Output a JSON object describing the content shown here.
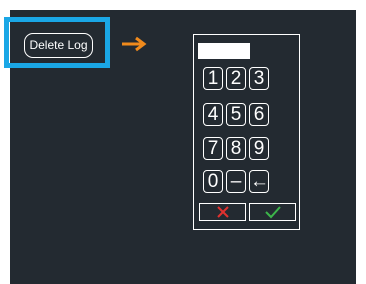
{
  "toolbar": {
    "delete_log_label": "Delete Log"
  },
  "keypad": {
    "display_value": "",
    "keys": [
      "1",
      "2",
      "3",
      "4",
      "5",
      "6",
      "7",
      "8",
      "9",
      "0",
      "–",
      "←"
    ],
    "cancel_icon": "x-icon",
    "confirm_icon": "check-icon"
  },
  "colors": {
    "background": "#232a31",
    "highlight": "#1aa7e6",
    "arrow": "#f08a1c",
    "cancel": "#e0312f",
    "confirm": "#3cb54a"
  }
}
